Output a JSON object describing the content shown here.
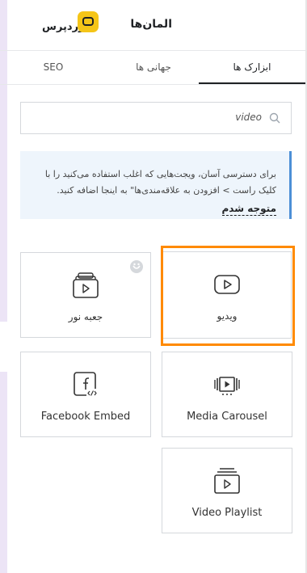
{
  "header": {
    "title": "المان‌ها",
    "logo_text": "وردپرس"
  },
  "tabs": [
    {
      "label": "ابزارک ها",
      "active": true
    },
    {
      "label": "جهانی ها",
      "active": false
    },
    {
      "label": "SEO",
      "active": false
    }
  ],
  "search": {
    "value": "video",
    "icon": "search-icon"
  },
  "notice": {
    "text": "برای دسترسی آسان، ویجت‌هایی که اغلب استفاده می‌کنید را با کلیک راست > افزودن به علاقه‌مندی‌ها\" به اینجا اضافه کنید.",
    "link": "متوجه شدم",
    "accent_color": "#4c8fd6"
  },
  "widgets": [
    {
      "label": "ویدیو",
      "icon": "video-play-icon",
      "highlighted": true
    },
    {
      "label": "جعبه نور",
      "icon": "lightbox-icon",
      "pro": true
    },
    {
      "label": "Media Carousel",
      "icon": "media-carousel-icon"
    },
    {
      "label": "Facebook Embed",
      "icon": "facebook-embed-icon"
    },
    {
      "label": "Video Playlist",
      "icon": "video-playlist-icon"
    }
  ],
  "colors": {
    "highlight": "#ff8a00",
    "logo": "#f5c518"
  }
}
